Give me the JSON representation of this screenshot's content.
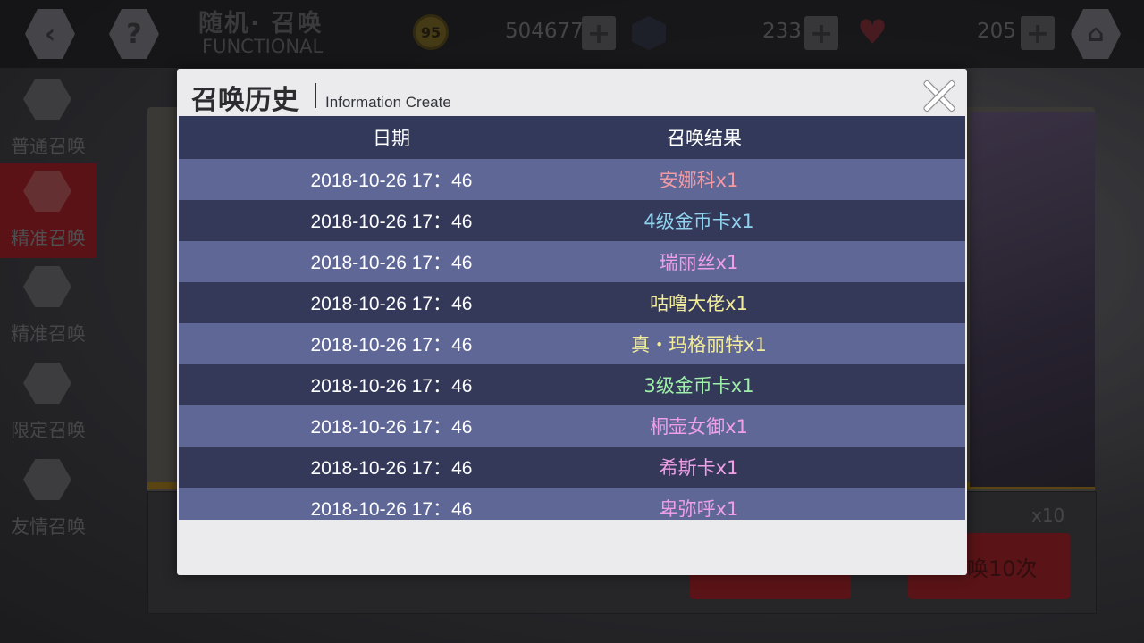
{
  "header": {
    "title_cn": "随机· 召唤",
    "title_en": "FUNCTIONAL",
    "back_icon": "‹",
    "help_icon": "?",
    "coin_label": "95",
    "coins": "504677",
    "gems": "233",
    "hearts": "205"
  },
  "sidebar": {
    "items": [
      {
        "label": "普通召唤"
      },
      {
        "label": "精准召唤"
      },
      {
        "label": "精准召唤"
      },
      {
        "label": "限定召唤"
      },
      {
        "label": "友情召唤"
      }
    ]
  },
  "background": {
    "x10": "x10",
    "summon10": "唤10次"
  },
  "modal": {
    "title": "召唤历史",
    "subtitle": "Information Create",
    "columns": {
      "date": "日期",
      "result": "召唤结果"
    },
    "rows": [
      {
        "date": "2018-10-26 17：46",
        "result": "安娜科x1",
        "color": "#f19aa3"
      },
      {
        "date": "2018-10-26 17：46",
        "result": "4级金币卡x1",
        "color": "#8fd3ee"
      },
      {
        "date": "2018-10-26 17：46",
        "result": "瑞丽丝x1",
        "color": "#ee9fe6"
      },
      {
        "date": "2018-10-26 17：46",
        "result": "咕噜大佬x1",
        "color": "#f1eb9c"
      },
      {
        "date": "2018-10-26 17：46",
        "result": "真・玛格丽特x1",
        "color": "#f1eb9c"
      },
      {
        "date": "2018-10-26 17：46",
        "result": "3级金币卡x1",
        "color": "#9ff0a8"
      },
      {
        "date": "2018-10-26 17：46",
        "result": "桐壶女御x1",
        "color": "#ee9fe6"
      },
      {
        "date": "2018-10-26 17：46",
        "result": "希斯卡x1",
        "color": "#ee9fe6"
      },
      {
        "date": "2018-10-26 17：46",
        "result": "卑弥呼x1",
        "color": "#ee9fe6"
      }
    ]
  }
}
